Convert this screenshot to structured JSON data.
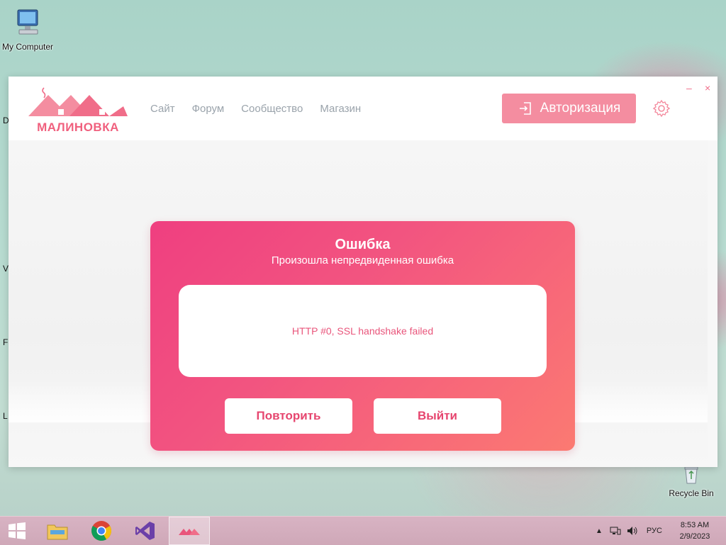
{
  "desktop": {
    "icons": [
      {
        "label": "My Computer"
      },
      {
        "label": "Recycle Bin"
      }
    ]
  },
  "app": {
    "logo_text": "МАЛИНОВКА",
    "nav": [
      {
        "label": "Сайт"
      },
      {
        "label": "Форум"
      },
      {
        "label": "Сообщество"
      },
      {
        "label": "Магазин"
      }
    ],
    "auth_label": "Авторизация",
    "window_controls": {
      "minimize": "–",
      "close": "×"
    },
    "error": {
      "title": "Ошибка",
      "subtitle": "Произошла непредвиденная ошибка",
      "message": "HTTP #0, SSL handshake failed",
      "retry_label": "Повторить",
      "exit_label": "Выйти"
    },
    "colors": {
      "accent": "#f48da0",
      "card_start": "#ef3f80",
      "card_end": "#fb7a72"
    }
  },
  "taskbar": {
    "items": [
      "start-icon",
      "file-explorer-icon",
      "chrome-icon",
      "visual-studio-icon",
      "malinovka-icon"
    ],
    "language": "РУС",
    "time": "8:53 AM",
    "date": "2/9/2023"
  }
}
